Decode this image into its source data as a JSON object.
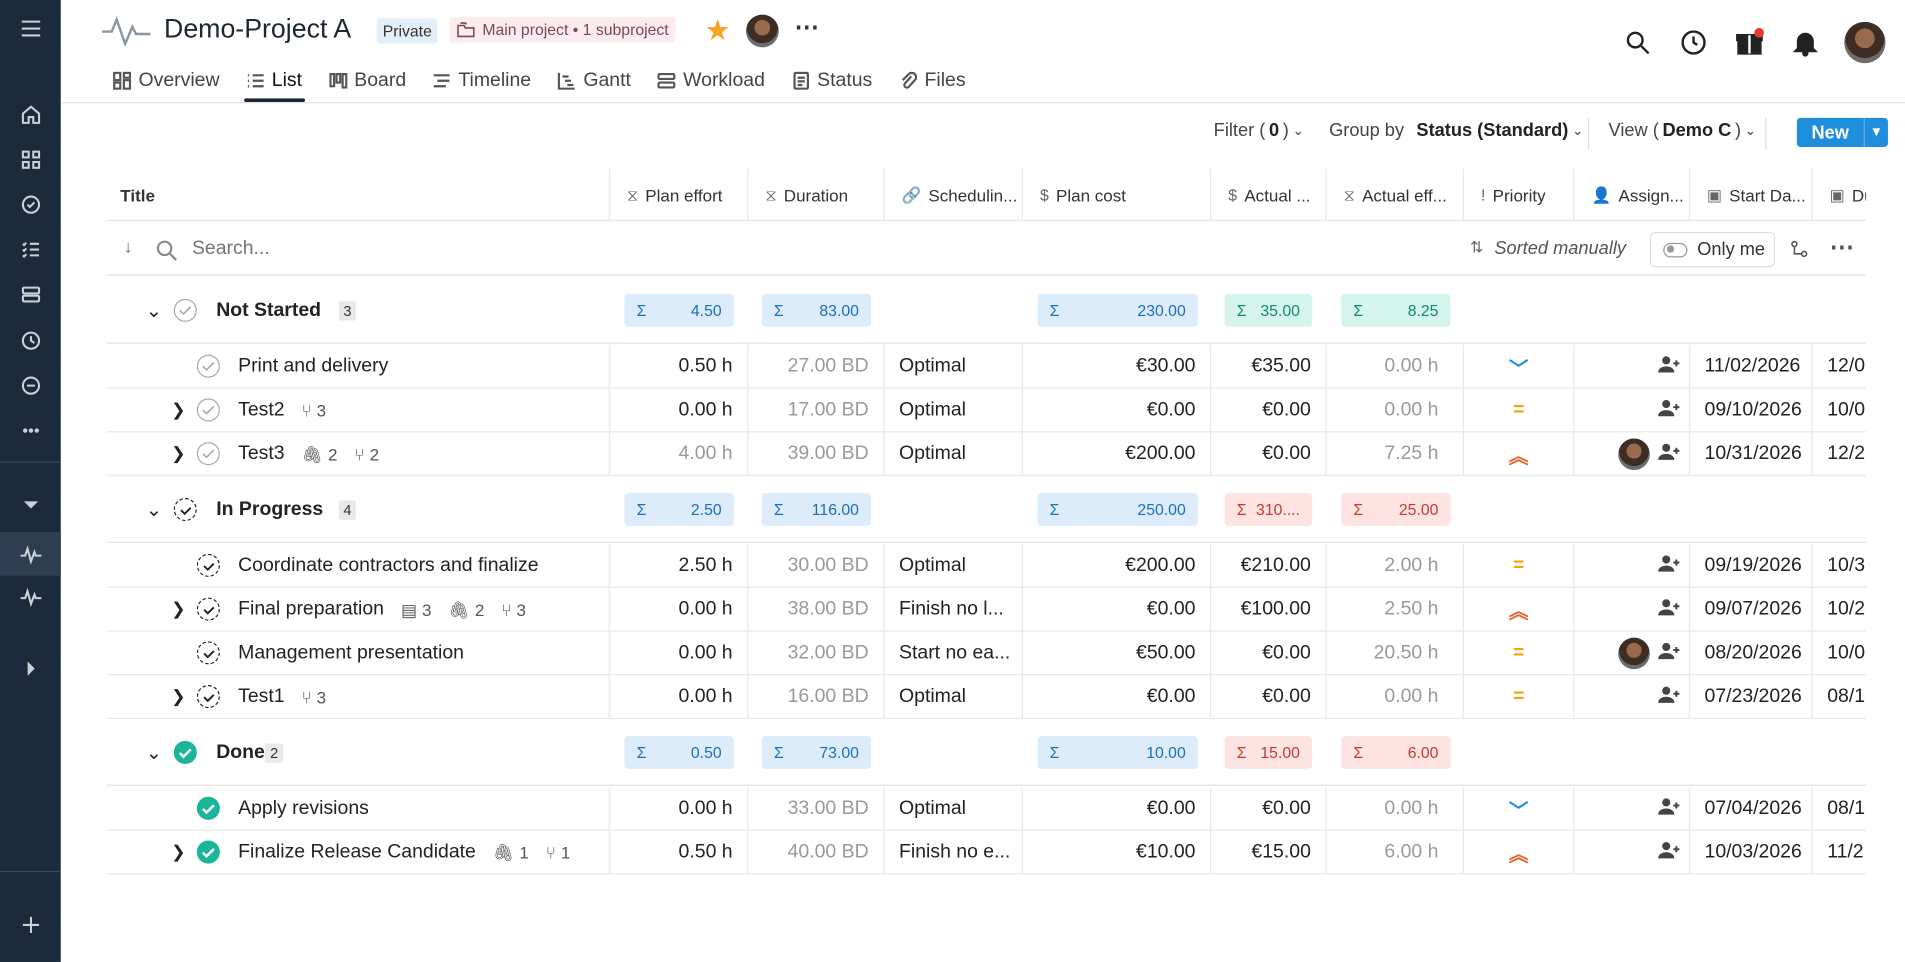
{
  "header": {
    "project_title": "Demo-Project A",
    "private_badge": "Private",
    "subproject_badge": "Main project • 1 subproject"
  },
  "tabs": [
    {
      "label": "Overview",
      "icon": "overview-icon"
    },
    {
      "label": "List",
      "icon": "list-icon",
      "active": true
    },
    {
      "label": "Board",
      "icon": "board-icon"
    },
    {
      "label": "Timeline",
      "icon": "timeline-icon"
    },
    {
      "label": "Gantt",
      "icon": "gantt-icon"
    },
    {
      "label": "Workload",
      "icon": "workload-icon"
    },
    {
      "label": "Status",
      "icon": "status-icon"
    },
    {
      "label": "Files",
      "icon": "paperclip-icon"
    }
  ],
  "toolbar": {
    "filter_label": "Filter (",
    "filter_count": "0",
    "filter_close": ")",
    "group_label": "Group by",
    "group_value": "Status (Standard)",
    "view_label": "View (",
    "view_value": "Demo C",
    "view_close": ")",
    "new_label": "New"
  },
  "columns": [
    "Title",
    "Plan effort",
    "Duration",
    "Schedulin...",
    "Plan cost",
    "Actual ...",
    "Actual eff...",
    "Priority",
    "Assign...",
    "Start Da...",
    "Du"
  ],
  "search": {
    "placeholder": "Search...",
    "sort_label": "Sorted manually",
    "only_me_label": "Only me"
  },
  "groups": [
    {
      "name": "Not Started",
      "count": "3",
      "status": "not-started",
      "sums": {
        "plan_effort": "4.50",
        "duration": "83.00",
        "plan_cost": "230.00",
        "actual_cost": "35.00",
        "actual_effort": "8.25"
      },
      "rows": [
        {
          "title": "Print and delivery",
          "expand": false,
          "meta": {},
          "plan_effort": "0.50 h",
          "duration": "27.00 BD",
          "scheduling": "Optimal",
          "plan_cost": "€30.00",
          "actual_cost": "€35.00",
          "actual_effort": "0.00 h",
          "priority": "low",
          "avatar": false,
          "start": "11/02/2026",
          "due": "12/0"
        },
        {
          "title": "Test2",
          "expand": true,
          "meta": {
            "subtasks": "3"
          },
          "plan_effort": "0.00 h",
          "duration": "17.00 BD",
          "scheduling": "Optimal",
          "plan_cost": "€0.00",
          "actual_cost": "€0.00",
          "actual_effort": "0.00 h",
          "priority": "medium",
          "avatar": false,
          "start": "09/10/2026",
          "due": "10/0"
        },
        {
          "title": "Test3",
          "expand": true,
          "meta": {
            "attachments": "2",
            "subtasks": "2"
          },
          "plan_effort": "4.00 h",
          "plan_effort_grey": true,
          "duration": "39.00 BD",
          "scheduling": "Optimal",
          "plan_cost": "€200.00",
          "actual_cost": "€0.00",
          "actual_effort": "7.25 h",
          "priority": "high",
          "avatar": true,
          "start": "10/31/2026",
          "due": "12/2"
        }
      ]
    },
    {
      "name": "In Progress",
      "count": "4",
      "status": "in-progress",
      "sums": {
        "plan_effort": "2.50",
        "duration": "116.00",
        "plan_cost": "250.00",
        "actual_cost": "310....",
        "actual_effort": "25.00"
      },
      "red": true,
      "rows": [
        {
          "title": "Coordinate contractors and finalize",
          "expand": false,
          "meta": {},
          "plan_effort": "2.50 h",
          "duration": "30.00 BD",
          "scheduling": "Optimal",
          "plan_cost": "€200.00",
          "actual_cost": "€210.00",
          "actual_effort": "2.00 h",
          "priority": "medium",
          "avatar": false,
          "start": "09/19/2026",
          "due": "10/3"
        },
        {
          "title": "Final preparation",
          "expand": true,
          "meta": {
            "comments": "3",
            "attachments": "2",
            "subtasks": "3"
          },
          "plan_effort": "0.00 h",
          "duration": "38.00 BD",
          "scheduling": "Finish no l...",
          "plan_cost": "€0.00",
          "actual_cost": "€100.00",
          "actual_effort": "2.50 h",
          "priority": "high",
          "avatar": false,
          "start": "09/07/2026",
          "due": "10/2"
        },
        {
          "title": "Management presentation",
          "expand": false,
          "meta": {},
          "plan_effort": "0.00 h",
          "duration": "32.00 BD",
          "scheduling": "Start no ea...",
          "plan_cost": "€50.00",
          "actual_cost": "€0.00",
          "actual_effort": "20.50 h",
          "priority": "medium",
          "avatar": true,
          "start": "08/20/2026",
          "due": "10/0"
        },
        {
          "title": "Test1",
          "expand": true,
          "meta": {
            "subtasks": "3"
          },
          "plan_effort": "0.00 h",
          "duration": "16.00 BD",
          "scheduling": "Optimal",
          "plan_cost": "€0.00",
          "actual_cost": "€0.00",
          "actual_effort": "0.00 h",
          "priority": "medium",
          "avatar": false,
          "start": "07/23/2026",
          "due": "08/1"
        }
      ]
    },
    {
      "name": "Done",
      "count": "2",
      "status": "done",
      "sums": {
        "plan_effort": "0.50",
        "duration": "73.00",
        "plan_cost": "10.00",
        "actual_cost": "15.00",
        "actual_effort": "6.00"
      },
      "red": true,
      "rows": [
        {
          "title": "Apply revisions",
          "expand": false,
          "meta": {},
          "plan_effort": "0.00 h",
          "duration": "33.00 BD",
          "scheduling": "Optimal",
          "plan_cost": "€0.00",
          "actual_cost": "€0.00",
          "actual_effort": "0.00 h",
          "priority": "low",
          "avatar": false,
          "start": "07/04/2026",
          "due": "08/1"
        },
        {
          "title": "Finalize Release Candidate",
          "expand": true,
          "meta": {
            "attachments": "1",
            "subtasks": "1"
          },
          "plan_effort": "0.50 h",
          "duration": "40.00 BD",
          "scheduling": "Finish no e...",
          "plan_cost": "€10.00",
          "actual_cost": "€15.00",
          "actual_effort": "6.00 h",
          "priority": "high",
          "avatar": false,
          "start": "10/03/2026",
          "due": "11/2"
        }
      ]
    }
  ],
  "colors": {
    "sidebar": "#1b2a3c",
    "accent": "#1f8fdd",
    "done": "#1bb59a",
    "priority_low": "#1f8fdd",
    "priority_medium": "#f0a30a",
    "priority_high": "#e8622c"
  }
}
